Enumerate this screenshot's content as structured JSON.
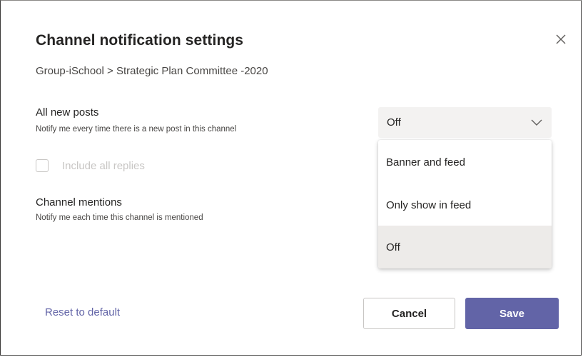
{
  "dialog": {
    "title": "Channel notification settings",
    "breadcrumb": "Group-iSchool > Strategic Plan Committee -2020",
    "close_icon": "close-icon"
  },
  "settings": {
    "all_posts": {
      "title": "All new posts",
      "description": "Notify me every time there is a new post in this channel",
      "selected_value": "Off",
      "options": [
        "Banner and feed",
        "Only show in feed",
        "Off"
      ]
    },
    "include_replies": {
      "label": "Include all replies",
      "checked": false,
      "disabled": true
    },
    "mentions": {
      "title": "Channel mentions",
      "description": "Notify me each time this channel is mentioned"
    }
  },
  "footer": {
    "reset_label": "Reset to default",
    "cancel_label": "Cancel",
    "save_label": "Save"
  },
  "colors": {
    "accent": "#6264a7",
    "select_bg": "#f3f2f1",
    "selected_option_bg": "#edebe9"
  }
}
